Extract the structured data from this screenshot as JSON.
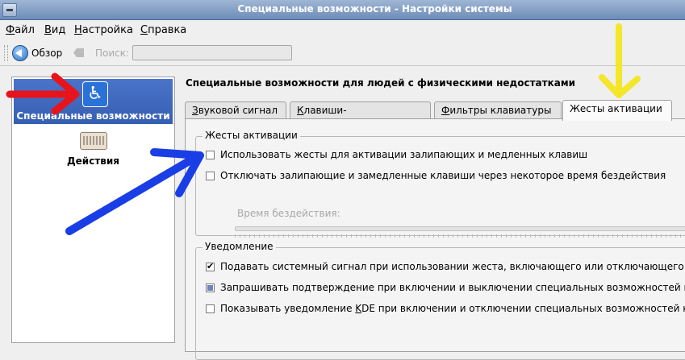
{
  "window": {
    "title": "Специальные возможности - Настройки системы"
  },
  "menu": [
    {
      "label": "Файл",
      "u": "Ф",
      "rest": "айл"
    },
    {
      "label": "Вид",
      "u": "В",
      "rest": "ид"
    },
    {
      "label": "Настройка",
      "u": "Н",
      "rest": "астройка"
    },
    {
      "label": "Справка",
      "u": "С",
      "rest": "правка"
    }
  ],
  "toolbar": {
    "overview_label": "Обзор",
    "search_label": "Поиск:",
    "search_value": ""
  },
  "sidebar": {
    "items": [
      {
        "label": "Специальные возможности",
        "icon": "accessibility-icon",
        "selected": true
      },
      {
        "label": "Действия",
        "icon": "keyboard-icon",
        "selected": false
      }
    ]
  },
  "page": {
    "title": "Специальные возможности для людей с физическими недостатками"
  },
  "tabs": [
    {
      "label": "Звуковой сигнал",
      "u": "З",
      "rest": "вуковой сигнал",
      "active": false
    },
    {
      "label": "Клавиши-модификаторы",
      "u": "К",
      "rest": "лавиши-модификаторы",
      "active": false
    },
    {
      "label": "Фильтры клавиатуры",
      "u": "Ф",
      "rest": "ильтры клавиатуры",
      "active": false
    },
    {
      "label": "Жесты активации",
      "active": true
    }
  ],
  "activation_group": {
    "title": "Жесты активации",
    "options": [
      {
        "label": "Использовать жесты для активации залипающих и медленных клавиш",
        "checked": false
      },
      {
        "label": "Отключать залипающие и замедленные клавиши через некоторое время бездействия",
        "checked": false
      }
    ],
    "idle_label": "Время бездействия:"
  },
  "notify_group": {
    "title": "Уведомление",
    "options": [
      {
        "label": "Подавать системный сигнал при использовании жеста, включающего или отключающего",
        "state": "checked"
      },
      {
        "label": "Запрашивать подтверждение при включении и выключении специальных возможностей к",
        "state": "partial"
      },
      {
        "label_pre": "Показывать уведомление ",
        "label_u": "K",
        "label_post": "DE при включении и отключении специальных возможностей к",
        "state": "unchecked"
      }
    ]
  },
  "annotation_colors": {
    "red": "#e8141c",
    "blue": "#1a3ee6",
    "yellow": "#f4e62a"
  }
}
